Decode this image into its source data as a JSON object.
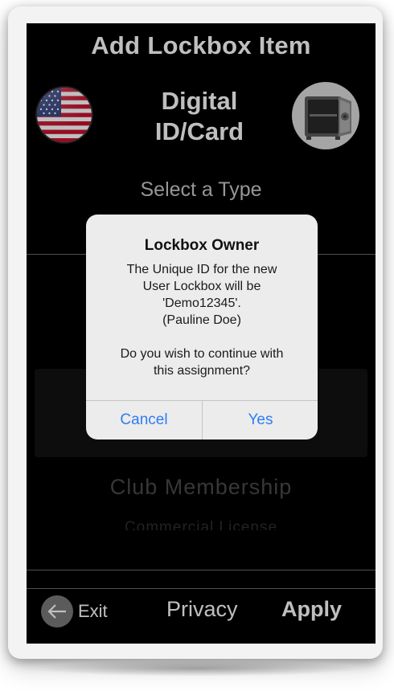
{
  "header": {
    "title": "Add Lockbox Item",
    "category_line1": "Digital",
    "category_line2": "ID/Card",
    "flag_icon": "us-flag-icon",
    "safe_icon": "open-safe-icon"
  },
  "picker": {
    "prompt": "Select a Type",
    "items": [
      {
        "label": "Club Membership"
      },
      {
        "label": "Commercial License"
      }
    ]
  },
  "footer": {
    "exit_label": "Exit",
    "exit_icon": "arrow-left-icon",
    "privacy_label": "Privacy",
    "apply_label": "Apply"
  },
  "alert": {
    "title": "Lockbox Owner",
    "message_lines": [
      "The Unique ID for the new",
      "User Lockbox will be",
      "'Demo12345'.",
      "(Pauline Doe)",
      "",
      "Do you wish to continue with",
      "this assignment?"
    ],
    "cancel_label": "Cancel",
    "confirm_label": "Yes",
    "button_color": "#2f7cf6"
  },
  "colors": {
    "screen_background": "#000000",
    "alert_background": "#ececec",
    "accent": "#2f7cf6"
  }
}
